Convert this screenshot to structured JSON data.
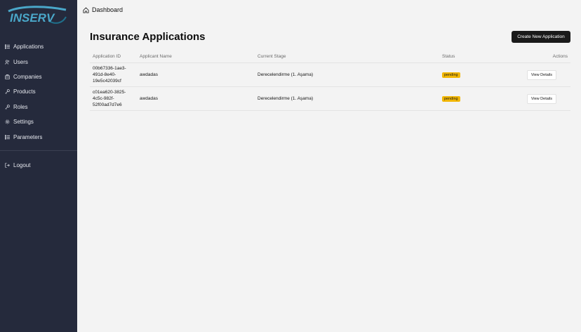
{
  "brand": {
    "logo_text": "INSERV",
    "logo_colors": [
      "#1f6f8b",
      "#4aa7c9"
    ]
  },
  "sidebar": {
    "items": [
      {
        "label": "Applications",
        "icon": "list-icon"
      },
      {
        "label": "Users",
        "icon": "users-icon"
      },
      {
        "label": "Companies",
        "icon": "building-icon"
      },
      {
        "label": "Products",
        "icon": "key-icon"
      },
      {
        "label": "Roles",
        "icon": "key-icon"
      },
      {
        "label": "Settings",
        "icon": "gear-icon"
      },
      {
        "label": "Parameters",
        "icon": "list-icon"
      }
    ],
    "logout": {
      "label": "Logout",
      "icon": "logout-icon"
    }
  },
  "breadcrumb": {
    "icon": "home-icon",
    "label": "Dashboard"
  },
  "page": {
    "title": "Insurance Applications",
    "create_label": "Create New Application"
  },
  "table": {
    "headers": [
      "Application ID",
      "Applicant Name",
      "Current Stage",
      "Status",
      "Actions"
    ],
    "rows": [
      {
        "id_lines": [
          "00b67336-1ae3-",
          "491d-8e40-",
          "19e5c42039cf"
        ],
        "applicant": "awdadas",
        "stage": "Derecelendirme (1. Aşama)",
        "status": "pending",
        "action": "View Details"
      },
      {
        "id_lines": [
          "c01ea620-3825-",
          "4c5c-982f-",
          "52f00ad7d7e6"
        ],
        "applicant": "awdadas",
        "stage": "Derecelendirme (1. Aşama)",
        "status": "pending",
        "action": "View Details"
      }
    ]
  },
  "colors": {
    "sidebar_bg": "#252a3c",
    "status_pending": "#f2b705",
    "primary_button": "#1a1a1a"
  }
}
